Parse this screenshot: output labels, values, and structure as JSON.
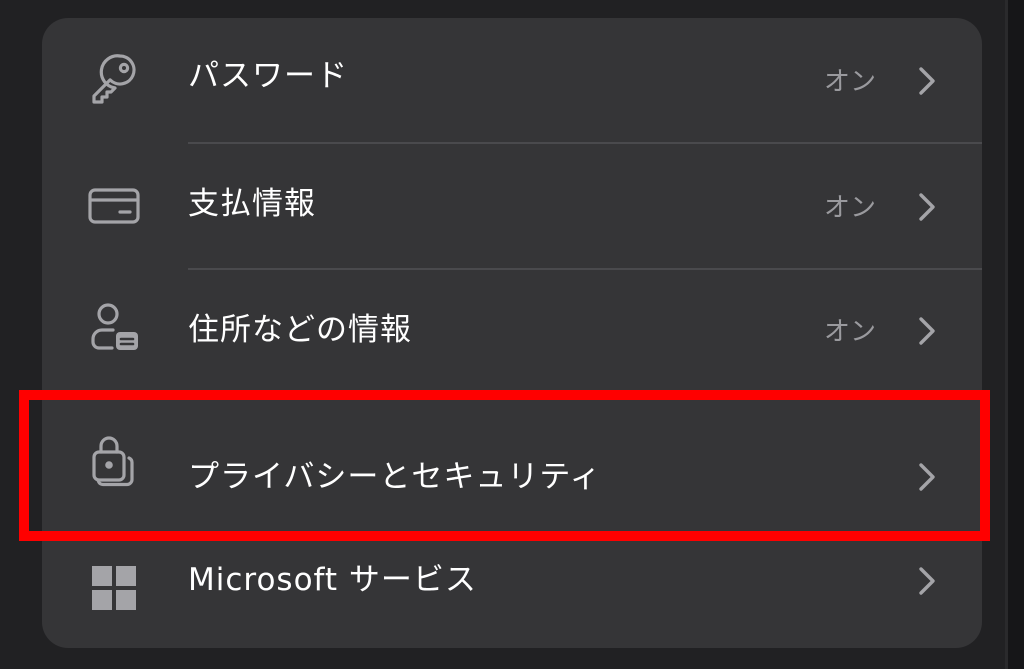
{
  "settings": {
    "items": [
      {
        "label": "パスワード",
        "status": "オン",
        "icon": "key-icon"
      },
      {
        "label": "支払情報",
        "status": "オン",
        "icon": "credit-card-icon"
      },
      {
        "label": "住所などの情報",
        "status": "オン",
        "icon": "contact-card-icon"
      },
      {
        "label": "プライバシーとセキュリティ",
        "status": "",
        "icon": "lock-icon"
      },
      {
        "label": "Microsoft サービス",
        "status": "",
        "icon": "microsoft-logo-icon"
      }
    ]
  },
  "colors": {
    "background": "#212123",
    "card": "#353537",
    "label_text": "#ffffff",
    "status_text": "#9a9a9e",
    "icon": "#a4a4a8",
    "divider": "#4a4a4d",
    "highlight": "#ff0000"
  }
}
